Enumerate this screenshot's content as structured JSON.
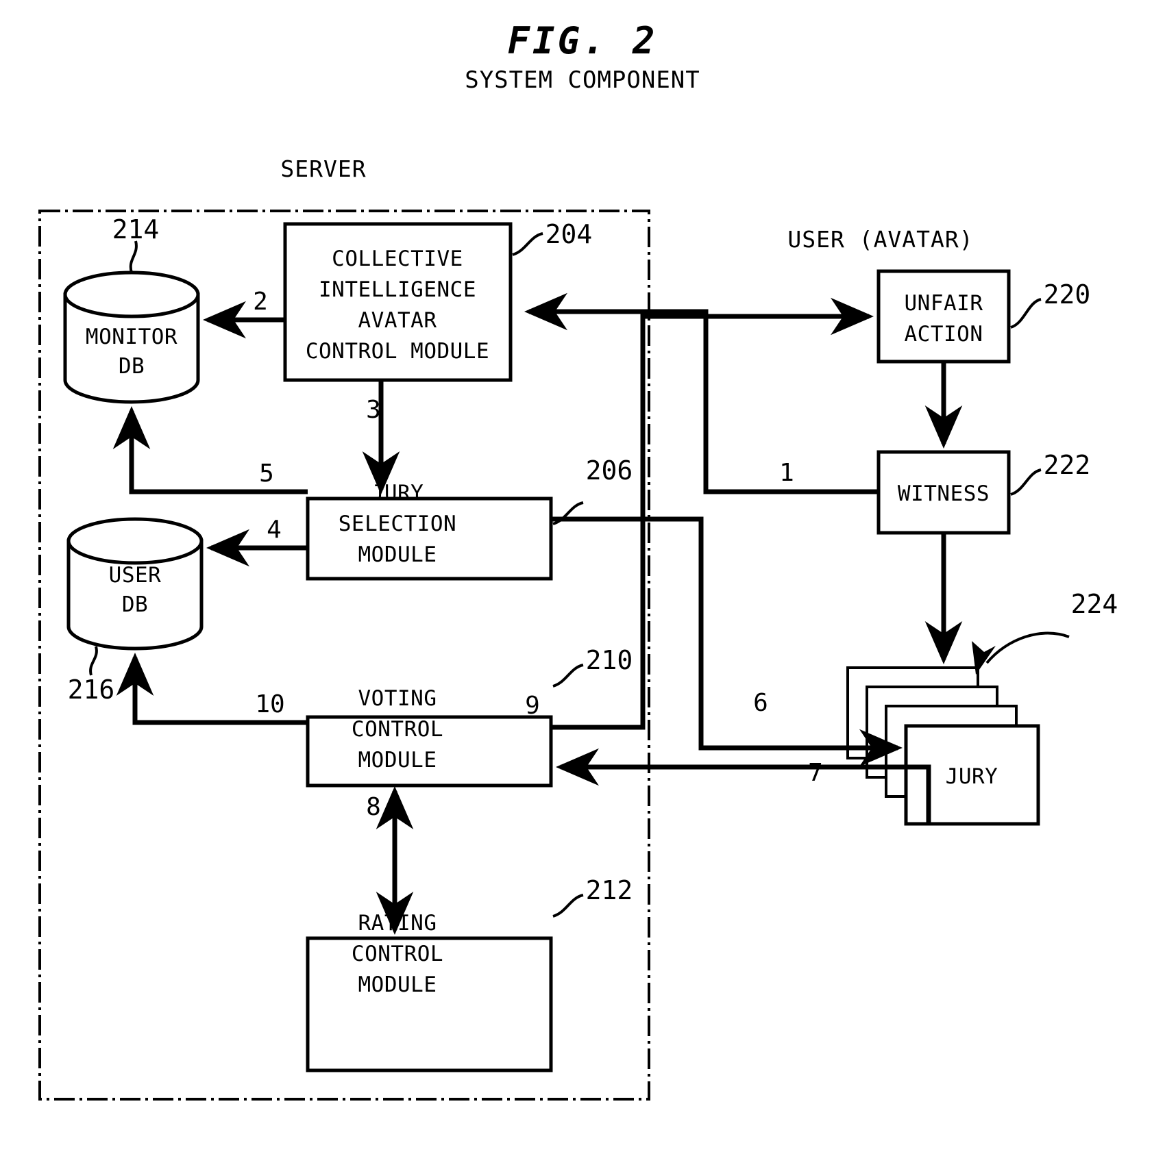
{
  "figure": {
    "title": "FIG. 2",
    "subtitle": "SYSTEM COMPONENT"
  },
  "groups": {
    "server_label": "SERVER",
    "user_label": "USER (AVATAR)"
  },
  "nodes": {
    "monitor_db": {
      "label_line1": "MONITOR",
      "label_line2": "DB",
      "ref": "214"
    },
    "user_db": {
      "label_line1": "USER",
      "label_line2": "DB",
      "ref": "216"
    },
    "collective_module": {
      "label_line1": "COLLECTIVE",
      "label_line2": "INTELLIGENCE",
      "label_line3": "AVATAR",
      "label_line4": "CONTROL MODULE",
      "ref": "204"
    },
    "jury_selection_module": {
      "label_line1": "JURY",
      "label_line2": "SELECTION",
      "label_line3": "MODULE",
      "ref": "206"
    },
    "voting_control_module": {
      "label_line1": "VOTING",
      "label_line2": "CONTROL",
      "label_line3": "MODULE",
      "ref": "210"
    },
    "rating_control_module": {
      "label_line1": "RATING",
      "label_line2": "CONTROL",
      "label_line3": "MODULE",
      "ref": "212"
    },
    "unfair_action": {
      "label_line1": "UNFAIR",
      "label_line2": "ACTION",
      "ref": "220"
    },
    "witness": {
      "label_line1": "WITNESS",
      "ref": "222"
    },
    "jury": {
      "label_line1": "JURY",
      "ref": "224"
    }
  },
  "flow_labels": {
    "n1": "1",
    "n2": "2",
    "n3": "3",
    "n4": "4",
    "n5": "5",
    "n6": "6",
    "n7": "7",
    "n8": "8",
    "n9": "9",
    "n10": "10"
  },
  "chart_data": {
    "type": "diagram",
    "title": "FIG. 2 SYSTEM COMPONENT",
    "nodes": [
      {
        "id": "204",
        "name": "COLLECTIVE INTELLIGENCE AVATAR CONTROL MODULE",
        "shape": "rect",
        "group": "SERVER"
      },
      {
        "id": "206",
        "name": "JURY SELECTION MODULE",
        "shape": "rect",
        "group": "SERVER"
      },
      {
        "id": "210",
        "name": "VOTING CONTROL MODULE",
        "shape": "rect",
        "group": "SERVER"
      },
      {
        "id": "212",
        "name": "RATING CONTROL MODULE",
        "shape": "rect",
        "group": "SERVER"
      },
      {
        "id": "214",
        "name": "MONITOR DB",
        "shape": "cylinder",
        "group": "SERVER"
      },
      {
        "id": "216",
        "name": "USER DB",
        "shape": "cylinder",
        "group": "SERVER"
      },
      {
        "id": "220",
        "name": "UNFAIR ACTION",
        "shape": "rect",
        "group": "USER (AVATAR)"
      },
      {
        "id": "222",
        "name": "WITNESS",
        "shape": "rect",
        "group": "USER (AVATAR)"
      },
      {
        "id": "224",
        "name": "JURY",
        "shape": "stacked-rect",
        "group": "USER (AVATAR)"
      }
    ],
    "edges": [
      {
        "label": "1",
        "from": "222",
        "to": "204"
      },
      {
        "label": "2",
        "from": "204",
        "to": "214"
      },
      {
        "label": "3",
        "from": "204",
        "to": "206"
      },
      {
        "label": "4",
        "from": "206",
        "to": "216"
      },
      {
        "label": "5",
        "from": "206",
        "to": "214"
      },
      {
        "label": "6",
        "from": "206",
        "to": "224"
      },
      {
        "label": "7",
        "from": "224",
        "to": "210"
      },
      {
        "label": "8",
        "from": "210",
        "to": "212",
        "bidirectional": true
      },
      {
        "label": "9",
        "from": "210",
        "to": "220"
      },
      {
        "label": "10",
        "from": "210",
        "to": "216"
      }
    ]
  }
}
